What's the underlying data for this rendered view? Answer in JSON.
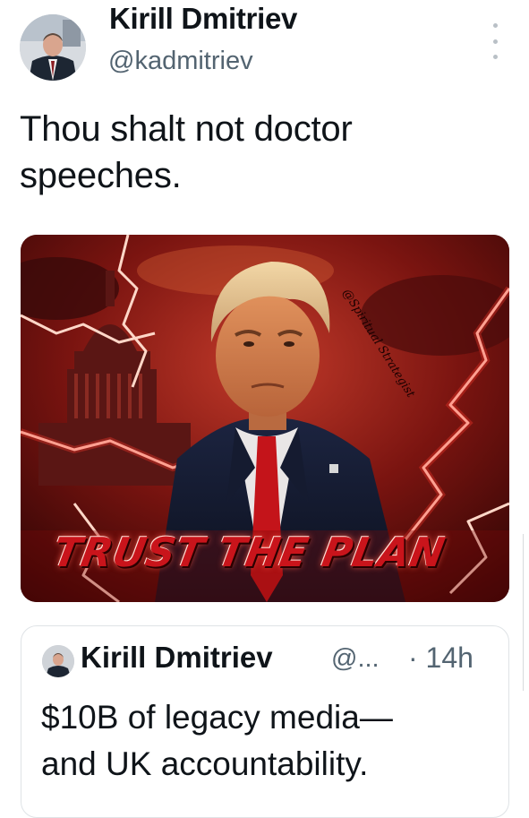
{
  "tweet": {
    "author_name": "Kirill Dmitriev",
    "author_handle": "@kadmitriev",
    "text": "Thou shalt not doctor\nspeeches.",
    "more_icon": "more-vertical-icon"
  },
  "media": {
    "caption": "TRUST THE PLAN",
    "watermark": "@Spiritual Strategist"
  },
  "quoted_tweet": {
    "author_name": "Kirill Dmitriev",
    "author_handle": "@...",
    "time": "· 14h",
    "text": "$10B of legacy media—\nand UK accountability."
  },
  "colors": {
    "text_primary": "#0f1419",
    "text_secondary": "#536471",
    "border": "#dfe3e6",
    "caption_red": "#c9141b"
  }
}
